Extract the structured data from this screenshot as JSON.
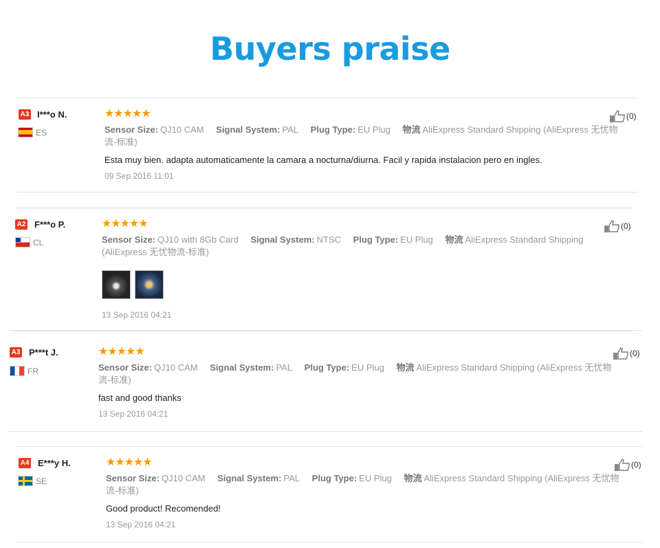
{
  "header": {
    "title": "Buyers praise"
  },
  "labels": {
    "sensor": "Sensor Size:",
    "signal": "Signal System:",
    "plug": "Plug Type:",
    "shipping": "物流"
  },
  "reviews": [
    {
      "badge": "A3",
      "name": "I***o N.",
      "country": "ES",
      "stars": "★★★★★",
      "sensor": "QJ10 CAM",
      "signal": "PAL",
      "plug": "EU Plug",
      "shipping_line1": "AliExpress Standard Shipping (AliExpress 无忧物",
      "shipping_line2": "流-标准)",
      "text": "Esta muy bien. adapta automaticamente la camara a nocturna/diurna. Facil y rapida instalacion pero en ingles.",
      "date": "09 Sep 2016 11:01",
      "helpful": "(0)"
    },
    {
      "badge": "A2",
      "name": "F***o P.",
      "country": "CL",
      "stars": "★★★★★",
      "sensor": "QJ10 with 8Gb Card",
      "signal": "NTSC",
      "plug": "EU Plug",
      "shipping_line1": "AliExpress Standard Shipping",
      "shipping_line2": "(AliExpress 无忧物流-标准)",
      "text": "",
      "date": "13 Sep 2016 04:21",
      "helpful": "(0)"
    },
    {
      "badge": "A3",
      "name": "P***t J.",
      "country": "FR",
      "stars": "★★★★★",
      "sensor": "QJ10 CAM",
      "signal": "PAL",
      "plug": "EU Plug",
      "shipping_line1": "AliExpress Standard Shipping (AliExpress 无忧物",
      "shipping_line2": "流-标准)",
      "text": "fast and good thanks",
      "date": "13 Sep 2016 04:21",
      "helpful": "(0)"
    },
    {
      "badge": "A4",
      "name": "E***y H.",
      "country": "SE",
      "stars": "★★★★★",
      "sensor": "QJ10 CAM",
      "signal": "PAL",
      "plug": "EU Plug",
      "shipping_line1": "AliExpress Standard Shipping (AliExpress 无忧物",
      "shipping_line2": "流-标准)",
      "text": "Good product! Recomended!",
      "date": "13 Sep 2016 04:21",
      "helpful": "(0)"
    }
  ]
}
